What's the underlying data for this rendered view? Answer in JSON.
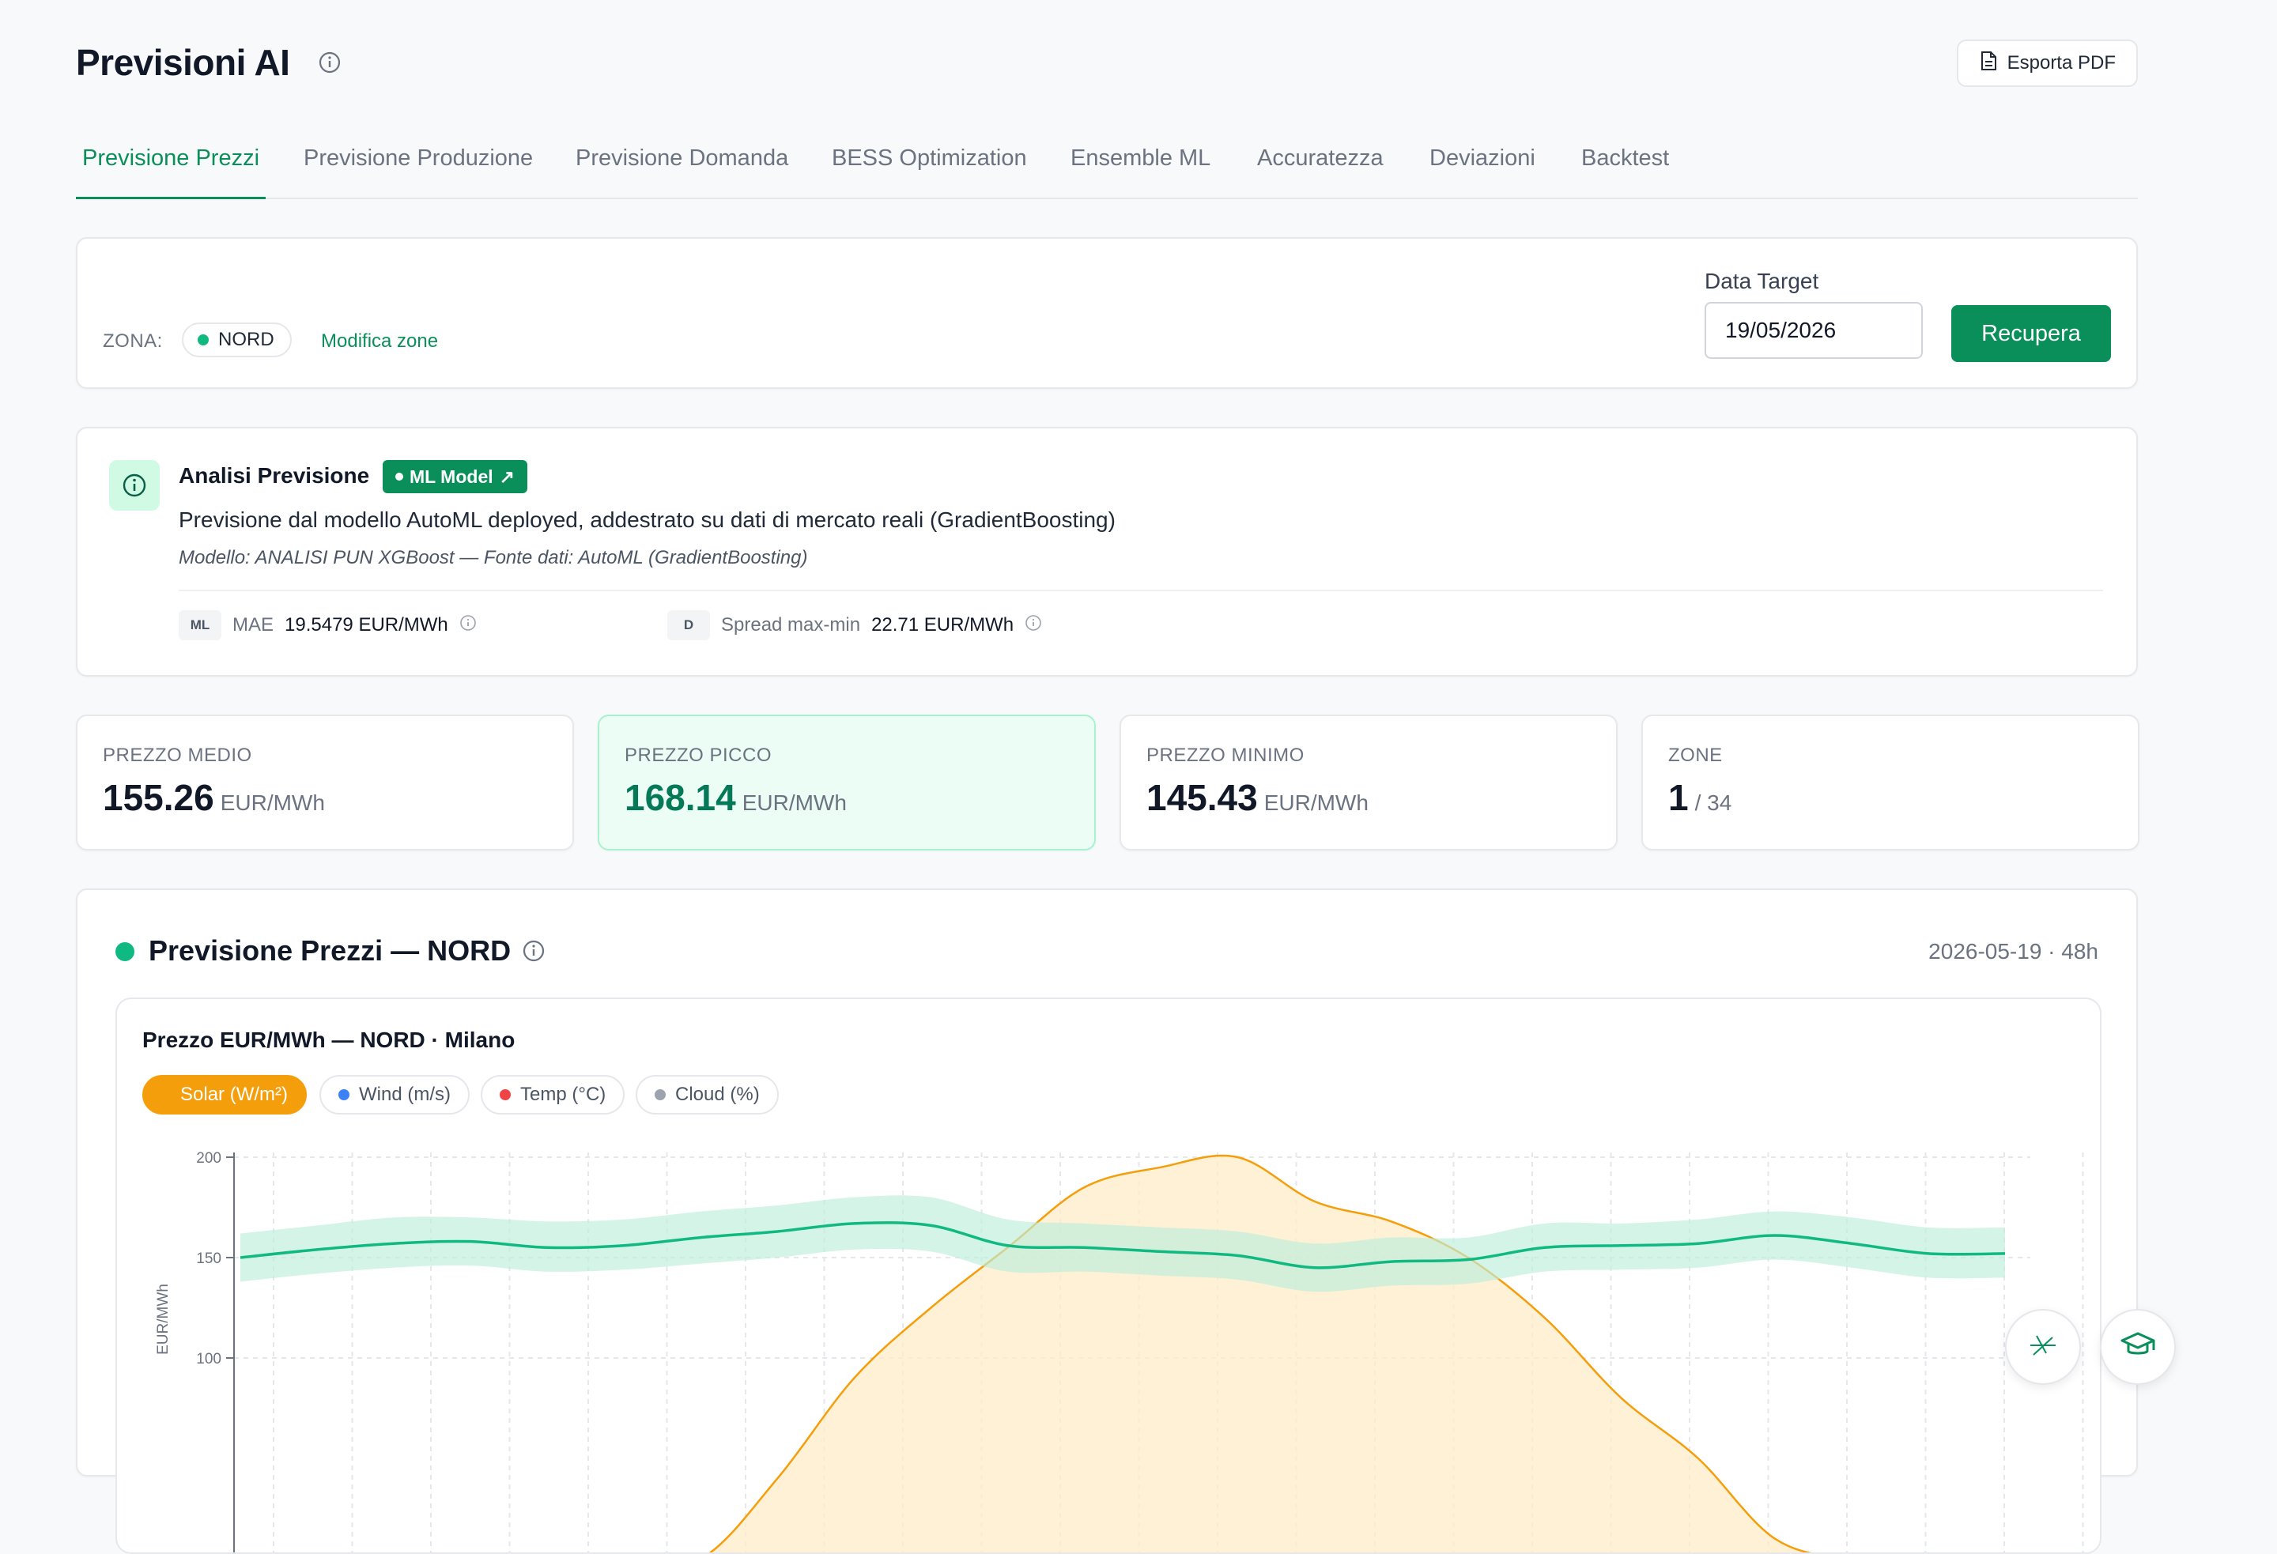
{
  "header": {
    "title": "Previsioni AI",
    "export_label": "Esporta PDF"
  },
  "tabs": [
    {
      "label": "Previsione Prezzi",
      "active": true
    },
    {
      "label": "Previsione Produzione"
    },
    {
      "label": "Previsione Domanda"
    },
    {
      "label": "BESS Optimization"
    },
    {
      "label": "Ensemble ML"
    },
    {
      "label": "Accuratezza"
    },
    {
      "label": "Deviazioni"
    },
    {
      "label": "Backtest"
    }
  ],
  "filters": {
    "zona_label": "ZONA:",
    "zona_value": "NORD",
    "modifica_label": "Modifica zone",
    "data_target_label": "Data Target",
    "data_target_value": "19/05/2026",
    "recupera_label": "Recupera"
  },
  "analysis": {
    "title": "Analisi Previsione",
    "badge": "ML Model",
    "description": "Previsione dal modello AutoML deployed, addestrato su dati di mercato reali (GradientBoosting)",
    "model_line": "Modello: ANALISI PUN XGBoost — Fonte dati: AutoML (GradientBoosting)",
    "metrics": [
      {
        "tag": "ML",
        "label": "MAE",
        "value": "19.5479 EUR/MWh"
      },
      {
        "tag": "D",
        "label": "Spread max-min",
        "value": "22.71 EUR/MWh"
      }
    ]
  },
  "stats": [
    {
      "label": "PREZZO MEDIO",
      "value": "155.26",
      "unit": "EUR/MWh"
    },
    {
      "label": "PREZZO PICCO",
      "value": "168.14",
      "unit": "EUR/MWh"
    },
    {
      "label": "PREZZO MINIMO",
      "value": "145.43",
      "unit": "EUR/MWh"
    },
    {
      "label": "ZONE",
      "value": "1",
      "unit": "/ 34"
    }
  ],
  "chart_section": {
    "title": "Previsione Prezzi — NORD",
    "meta": "2026-05-19 · 48h",
    "inner_title": "Prezzo EUR/MWh — NORD · Milano",
    "overlays": [
      {
        "label": "Solar (W/m²)",
        "color": "#f59e0b",
        "active": true
      },
      {
        "label": "Wind (m/s)",
        "color": "#3b82f6"
      },
      {
        "label": "Temp (°C)",
        "color": "#ef4444"
      },
      {
        "label": "Cloud (%)",
        "color": "#9ca3af"
      }
    ]
  },
  "chart_data": {
    "type": "line",
    "ylabel": "EUR/MWh",
    "ylim": [
      0,
      200
    ],
    "yticks": [
      100,
      150,
      200
    ],
    "x": [
      0,
      1,
      2,
      3,
      4,
      5,
      6,
      7,
      8,
      9,
      10,
      11,
      12,
      13,
      14,
      15,
      16,
      17,
      18,
      19,
      20,
      21,
      22,
      23
    ],
    "series": [
      {
        "name": "price",
        "color": "#10b981",
        "values": [
          150,
          154,
          157,
          158,
          155,
          156,
          160,
          163,
          167,
          166,
          156,
          155,
          153,
          151,
          145,
          148,
          149,
          155,
          156,
          157,
          161,
          157,
          152,
          152
        ]
      },
      {
        "name": "price_band_upper",
        "color": "#d1f5e6",
        "values": [
          162,
          166,
          170,
          170,
          168,
          169,
          173,
          176,
          180,
          180,
          169,
          167,
          165,
          163,
          157,
          160,
          160,
          167,
          167,
          169,
          173,
          170,
          165,
          165
        ]
      },
      {
        "name": "price_band_lower",
        "color": "#d1f5e6",
        "values": [
          138,
          142,
          145,
          146,
          143,
          144,
          147,
          150,
          154,
          153,
          143,
          143,
          141,
          139,
          133,
          136,
          137,
          143,
          144,
          145,
          149,
          145,
          140,
          140
        ]
      },
      {
        "name": "solar",
        "color": "#f59e0b",
        "values": [
          0,
          0,
          0,
          0,
          0,
          0,
          0,
          40,
          90,
          125,
          155,
          185,
          195,
          200,
          178,
          168,
          150,
          120,
          80,
          50,
          10,
          0,
          0,
          0
        ]
      }
    ]
  }
}
